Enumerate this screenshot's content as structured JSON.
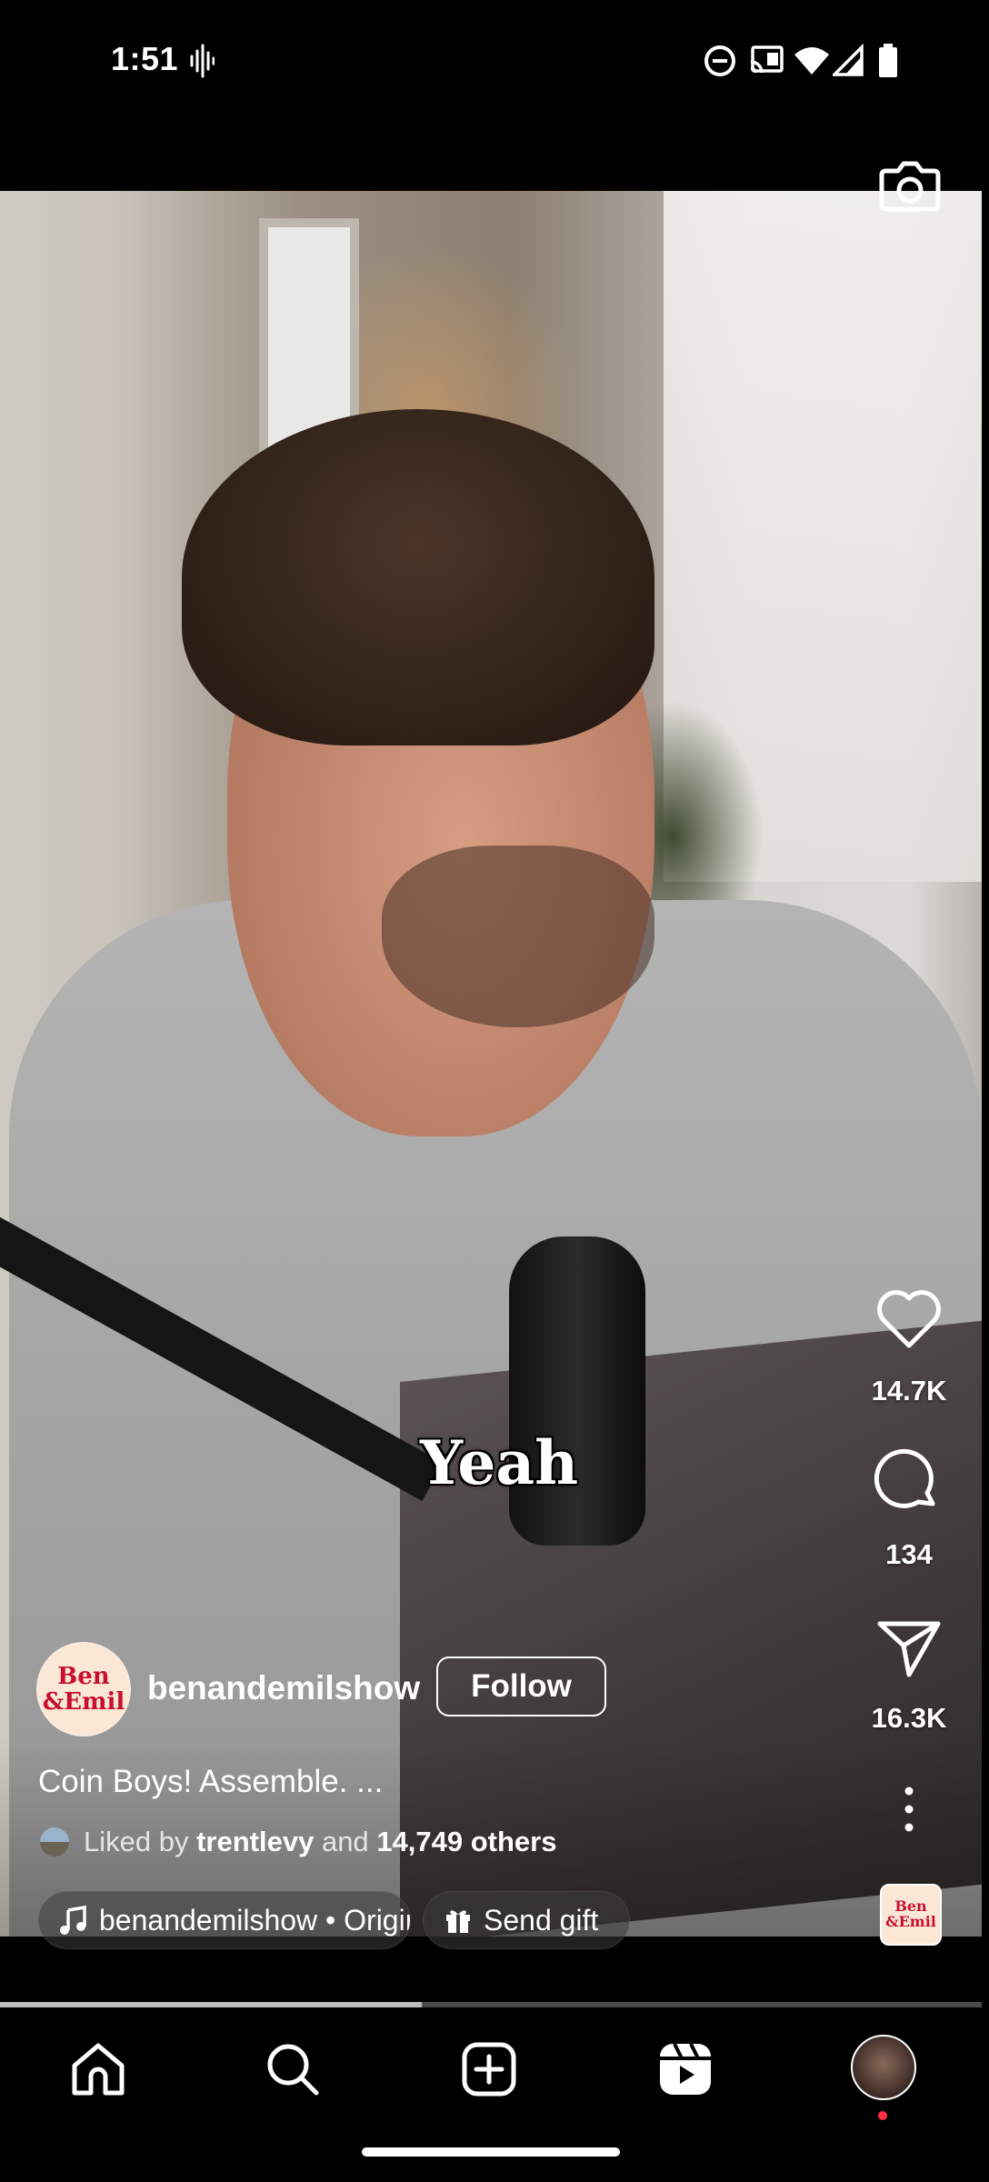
{
  "status_bar": {
    "time": "1:51",
    "icons": [
      "voicemail-wave-icon",
      "do-not-disturb-icon",
      "cast-icon",
      "wifi-icon",
      "cellular-signal-icon",
      "battery-icon"
    ]
  },
  "video": {
    "caption_overlay": "Yeah",
    "progress_fraction": 0.43
  },
  "actions": {
    "likes": "14.7K",
    "comments": "134",
    "shares": "16.3K"
  },
  "post": {
    "avatar_text": "Ben\n&Emil",
    "username": "benandemilshow",
    "follow_label": "Follow",
    "caption": "Coin Boys! Assemble. ...",
    "liked_prefix": "Liked by",
    "liked_user": "trentlevy",
    "liked_and": "and",
    "liked_others": "14,749 others",
    "audio_label": "benandemilshow • Original audio",
    "gift_label": "Send gift"
  },
  "nav": {
    "items": [
      "home-icon",
      "search-icon",
      "create-icon",
      "reels-icon",
      "profile-avatar"
    ]
  },
  "colors": {
    "accent_notification": "#ff3040",
    "logo_red": "#c8102e"
  }
}
